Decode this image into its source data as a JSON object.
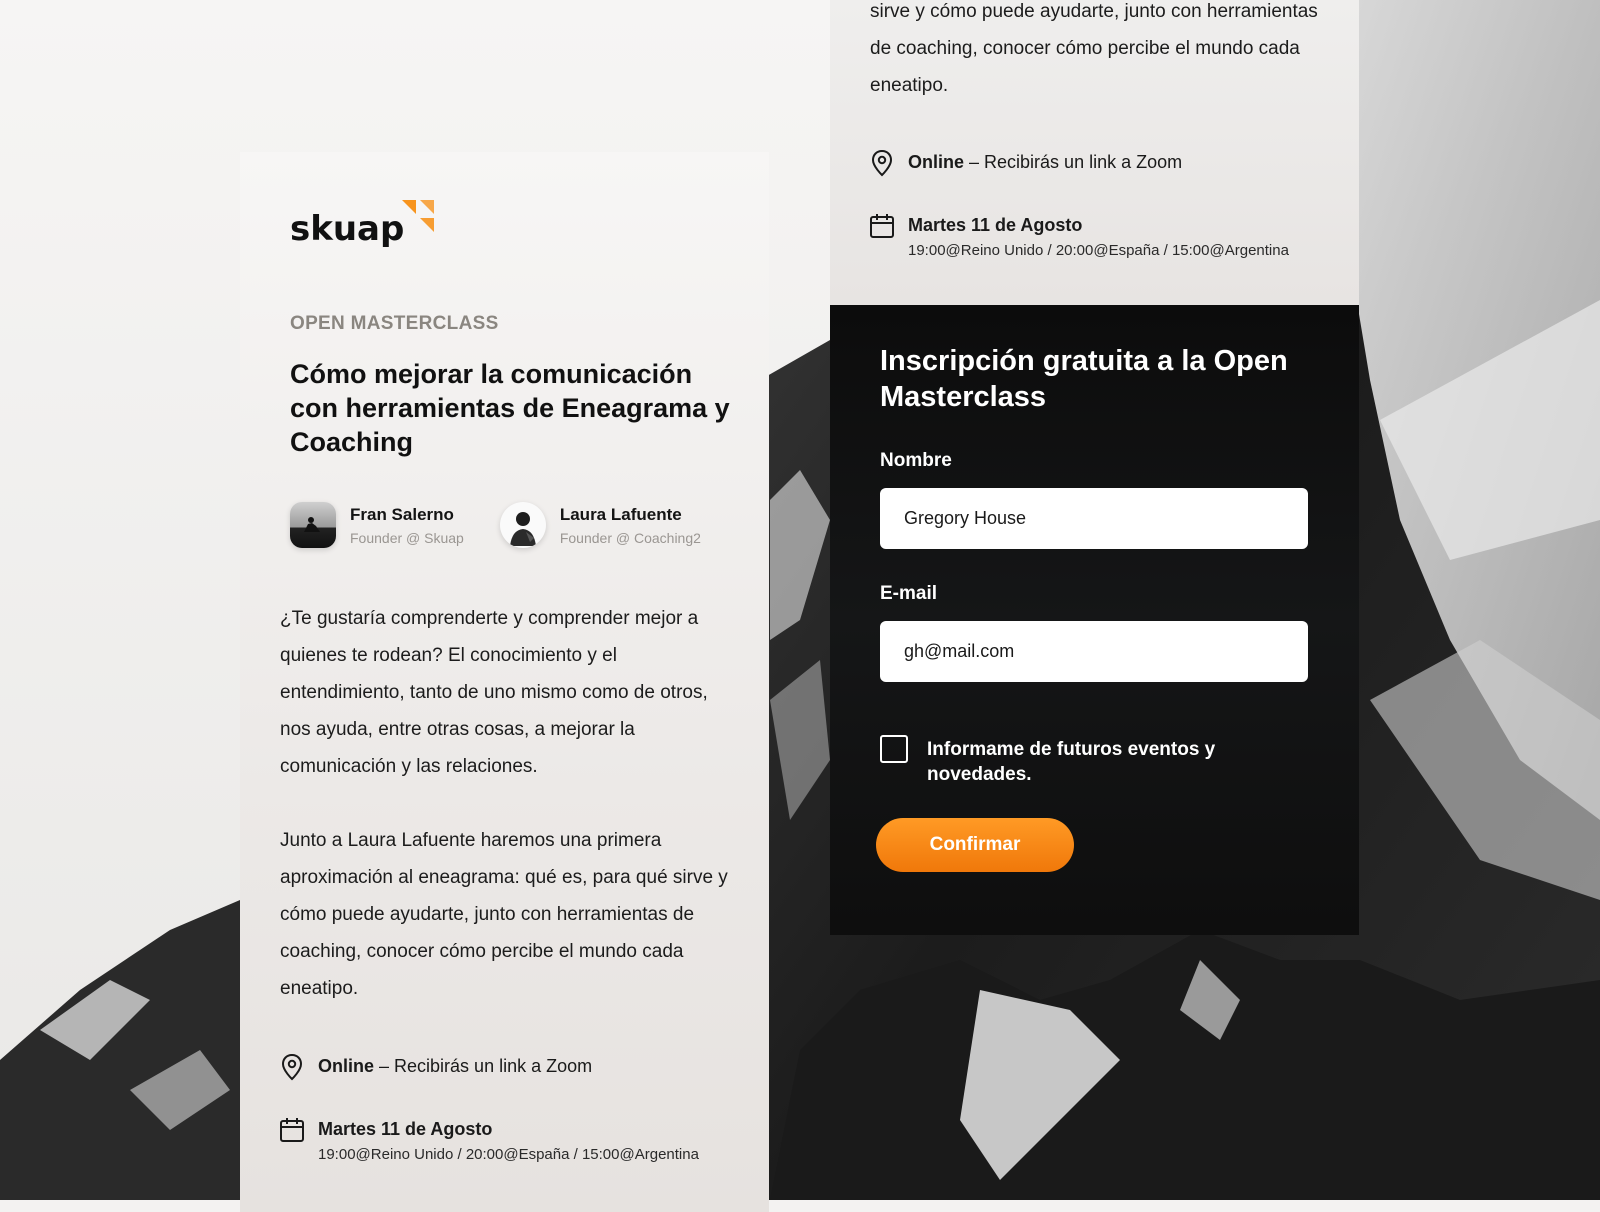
{
  "brand": {
    "name": "skuap",
    "accent": "#f7941d"
  },
  "event": {
    "eyebrow": "OPEN MASTERCLASS",
    "title": "Cómo mejorar la comunicación con herramientas de Eneagrama y Coaching"
  },
  "speakers": [
    {
      "name": "Fran Salerno",
      "role": "Founder @ Skuap"
    },
    {
      "name": "Laura Lafuente",
      "role": "Founder @ Coaching2"
    }
  ],
  "description": {
    "p1": "¿Te gustaría comprenderte y comprender mejor a quienes te rodean?  El conocimiento y el entendimiento, tanto de uno mismo como de otros, nos ayuda, entre otras cosas, a mejorar la comunicación y las relaciones.",
    "p2": "Junto a Laura Lafuente haremos una primera aproximación al eneagrama: qué es, para qué sirve y cómo puede ayudarte, junto con herramientas de coaching, conocer cómo percibe el mundo cada eneatipo.",
    "p2_tail": "sirve y cómo puede ayudarte, junto con herramientas de coaching, conocer cómo percibe el mundo cada eneatipo."
  },
  "location": {
    "mode": "Online",
    "detail": " – Recibirás un link a Zoom"
  },
  "date": {
    "label": "Martes 11 de Agosto",
    "times": "19:00@Reino Unido / 20:00@España / 15:00@Argentina"
  },
  "form": {
    "title": "Inscripción gratuita a la Open Masterclass",
    "name_label": "Nombre",
    "name_value": "Gregory House",
    "email_label": "E-mail",
    "email_value": "gh@mail.com",
    "checkbox_label": "Informame de futuros eventos y novedades.",
    "checkbox_checked": false,
    "submit_label": "Confirmar"
  },
  "icons": {
    "location": "map-pin-icon",
    "calendar": "calendar-icon"
  }
}
